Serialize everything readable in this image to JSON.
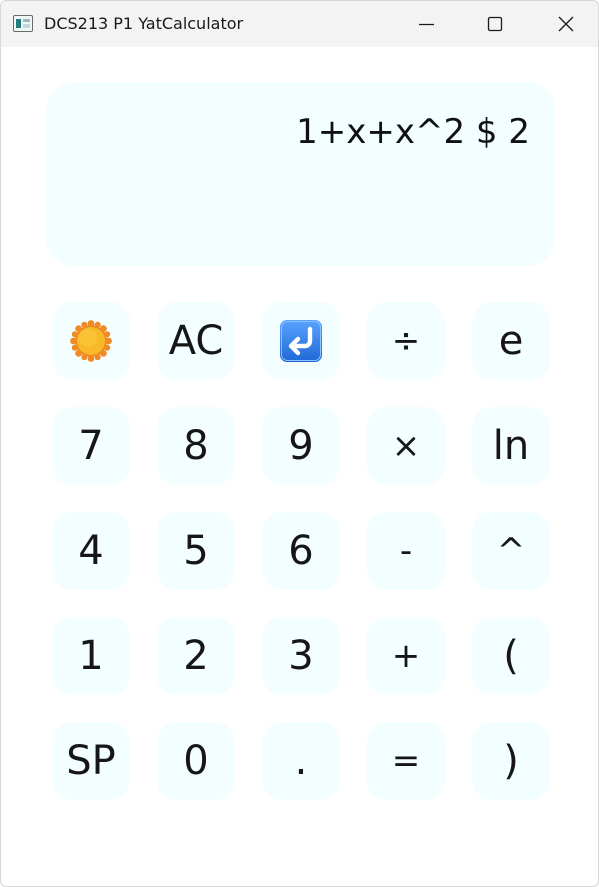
{
  "window": {
    "title": "DCS213 P1 YatCalculator"
  },
  "display": {
    "expression": "1+x+x^2 $ 2"
  },
  "keys": [
    {
      "label": "",
      "icon": "sun-icon"
    },
    {
      "label": "AC"
    },
    {
      "label": "",
      "icon": "return-arrow-icon"
    },
    {
      "label": "÷"
    },
    {
      "label": "e"
    },
    {
      "label": "7"
    },
    {
      "label": "8"
    },
    {
      "label": "9"
    },
    {
      "label": "×"
    },
    {
      "label": "ln"
    },
    {
      "label": "4"
    },
    {
      "label": "5"
    },
    {
      "label": "6"
    },
    {
      "label": "-"
    },
    {
      "label": "^"
    },
    {
      "label": "1"
    },
    {
      "label": "2"
    },
    {
      "label": "3"
    },
    {
      "label": "+"
    },
    {
      "label": "("
    },
    {
      "label": "SP"
    },
    {
      "label": "0"
    },
    {
      "label": "."
    },
    {
      "label": "="
    },
    {
      "label": ")"
    }
  ],
  "colors": {
    "key_background": "#f2feff",
    "display_background": "#f2feff",
    "titlebar_background": "#f3f3f3",
    "sun_fill": "#f7b928",
    "sun_rays": "#f08a24",
    "return_icon_fill": "#2f7fe8"
  }
}
